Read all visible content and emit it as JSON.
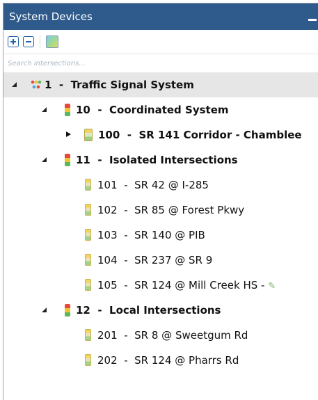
{
  "panel": {
    "title": "System Devices",
    "minimize_icon": "minimize-icon"
  },
  "toolbar": {
    "expand_all_icon": "plus-box-icon",
    "collapse_all_icon": "minus-box-icon",
    "map_icon": "map-icon"
  },
  "search": {
    "placeholder": "Search intersections..."
  },
  "tree": {
    "root": {
      "id": "1",
      "sep": "-",
      "name": "Traffic Signal System"
    },
    "coordinated": {
      "id": "10",
      "sep": "-",
      "name": "Coordinated System"
    },
    "corridor": {
      "id": "100",
      "sep": "-",
      "name": "SR 141 Corridor - Chamblee"
    },
    "isolated": {
      "id": "11",
      "sep": "-",
      "name": "Isolated Intersections"
    },
    "isolated_items": [
      {
        "id": "101",
        "sep": "-",
        "name": "SR 42 @ I-285"
      },
      {
        "id": "102",
        "sep": "-",
        "name": "SR 85 @ Forest Pkwy"
      },
      {
        "id": "103",
        "sep": "-",
        "name": "SR 140 @ PIB"
      },
      {
        "id": "104",
        "sep": "-",
        "name": "SR 237 @ SR 9"
      },
      {
        "id": "105",
        "sep": "-",
        "name": "SR 124 @ Mill Creek HS -"
      }
    ],
    "local": {
      "id": "12",
      "sep": "-",
      "name": "Local Intersections"
    },
    "local_items": [
      {
        "id": "201",
        "sep": "-",
        "name": "SR 8 @ Sweetgum Rd"
      },
      {
        "id": "202",
        "sep": "-",
        "name": "SR 124 @ Pharrs Rd"
      }
    ]
  },
  "colors": {
    "titlebar": "#2f5b8c",
    "selected_row": "#e6e6e6",
    "accent": "#1f5fa8"
  }
}
